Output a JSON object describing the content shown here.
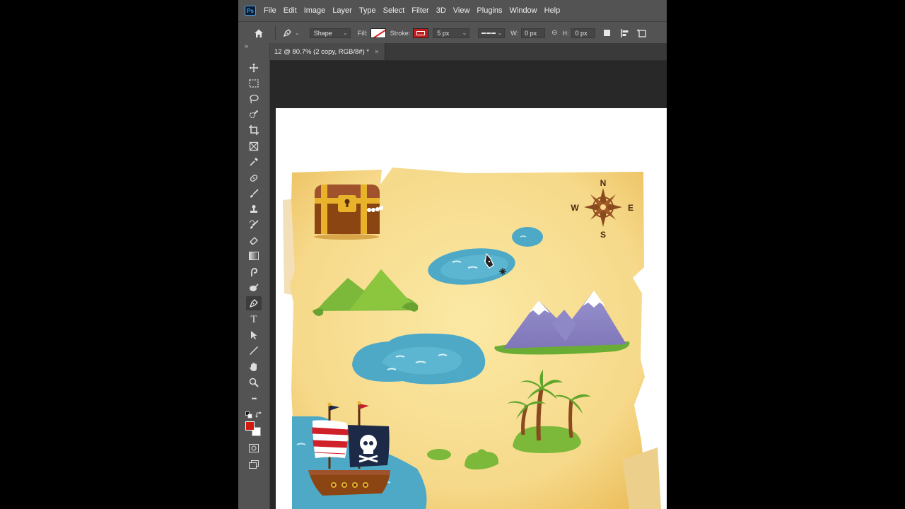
{
  "app": {
    "logo_text": "Ps",
    "menu": [
      "File",
      "Edit",
      "Image",
      "Layer",
      "Type",
      "Select",
      "Filter",
      "3D",
      "View",
      "Plugins",
      "Window",
      "Help"
    ]
  },
  "options_bar": {
    "tool_mode": "Shape",
    "fill_label": "Fill:",
    "stroke_label": "Stroke:",
    "stroke_width": "5 px",
    "width_label": "W:",
    "width_value": "0 px",
    "height_label": "H:",
    "height_value": "0 px"
  },
  "document_tab": {
    "title": "12 @ 80.7% (2 copy, RGB/8#) *",
    "close": "×"
  },
  "toolbar": {
    "collapse": "»",
    "tools": [
      "move-tool",
      "marquee-tool",
      "lasso-tool",
      "quick-selection-tool",
      "crop-tool",
      "frame-tool",
      "eyedropper-tool",
      "healing-brush-tool",
      "brush-tool",
      "clone-stamp-tool",
      "history-brush-tool",
      "eraser-tool",
      "gradient-tool",
      "smudge-tool",
      "dodge-tool",
      "pen-tool",
      "type-tool",
      "path-selection-tool",
      "line-tool",
      "hand-tool",
      "zoom-tool",
      "more-tools"
    ],
    "type_glyph": "T",
    "more_glyph": "•••",
    "active_tool": "pen-tool",
    "foreground_color": "#d11b10",
    "background_color": "#ffffff"
  },
  "artwork": {
    "compass": {
      "n": "N",
      "s": "S",
      "e": "E",
      "w": "W"
    }
  }
}
